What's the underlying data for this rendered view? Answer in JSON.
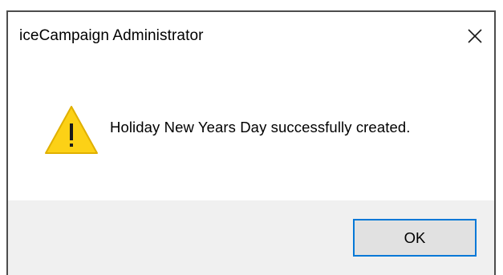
{
  "dialog": {
    "title": "iceCampaign Administrator",
    "message": "Holiday New Years Day successfully created.",
    "ok_label": "OK",
    "close_icon": "close-icon",
    "message_icon": "warning-icon"
  },
  "colors": {
    "warning_fill": "#fcd116",
    "warning_stroke": "#e0b000",
    "button_focus_border": "#0078d7",
    "footer_background": "#f0f0f0"
  }
}
